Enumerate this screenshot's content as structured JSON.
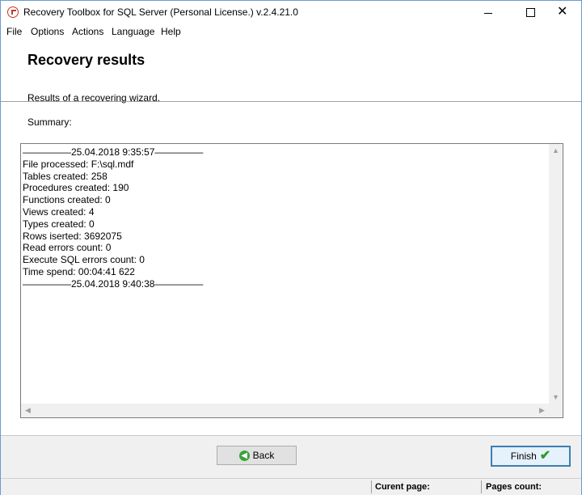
{
  "window": {
    "title": "Recovery Toolbox for SQL Server (Personal License.) v.2.4.21.0"
  },
  "menu": {
    "items": [
      {
        "label": "File"
      },
      {
        "label": "Options"
      },
      {
        "label": "Actions"
      },
      {
        "label": "Language"
      },
      {
        "label": "Help"
      }
    ]
  },
  "header": {
    "title": "Recovery results",
    "subtitle": "Results of a recovering wizard."
  },
  "summary": {
    "label": "Summary:",
    "lines": [
      "—————25.04.2018 9:35:57—————",
      "File processed: F:\\sql.mdf",
      "Tables created: 258",
      "Procedures created: 190",
      "Functions created: 0",
      "Views created: 4",
      "Types created: 0",
      "Rows iserted: 3692075",
      "Read errors count: 0",
      "Execute SQL errors count: 0",
      "Time spend: 00:04:41 622",
      "—————25.04.2018 9:40:38—————"
    ]
  },
  "buttons": {
    "back": "Back",
    "finish": "Finish"
  },
  "statusbar": {
    "current_page_label": "Curent page:",
    "pages_count_label": "Pages count:"
  },
  "icons": {
    "app": "recovery-toolbox-icon",
    "back": "back-arrow-icon",
    "finish": "checkmark-icon"
  }
}
